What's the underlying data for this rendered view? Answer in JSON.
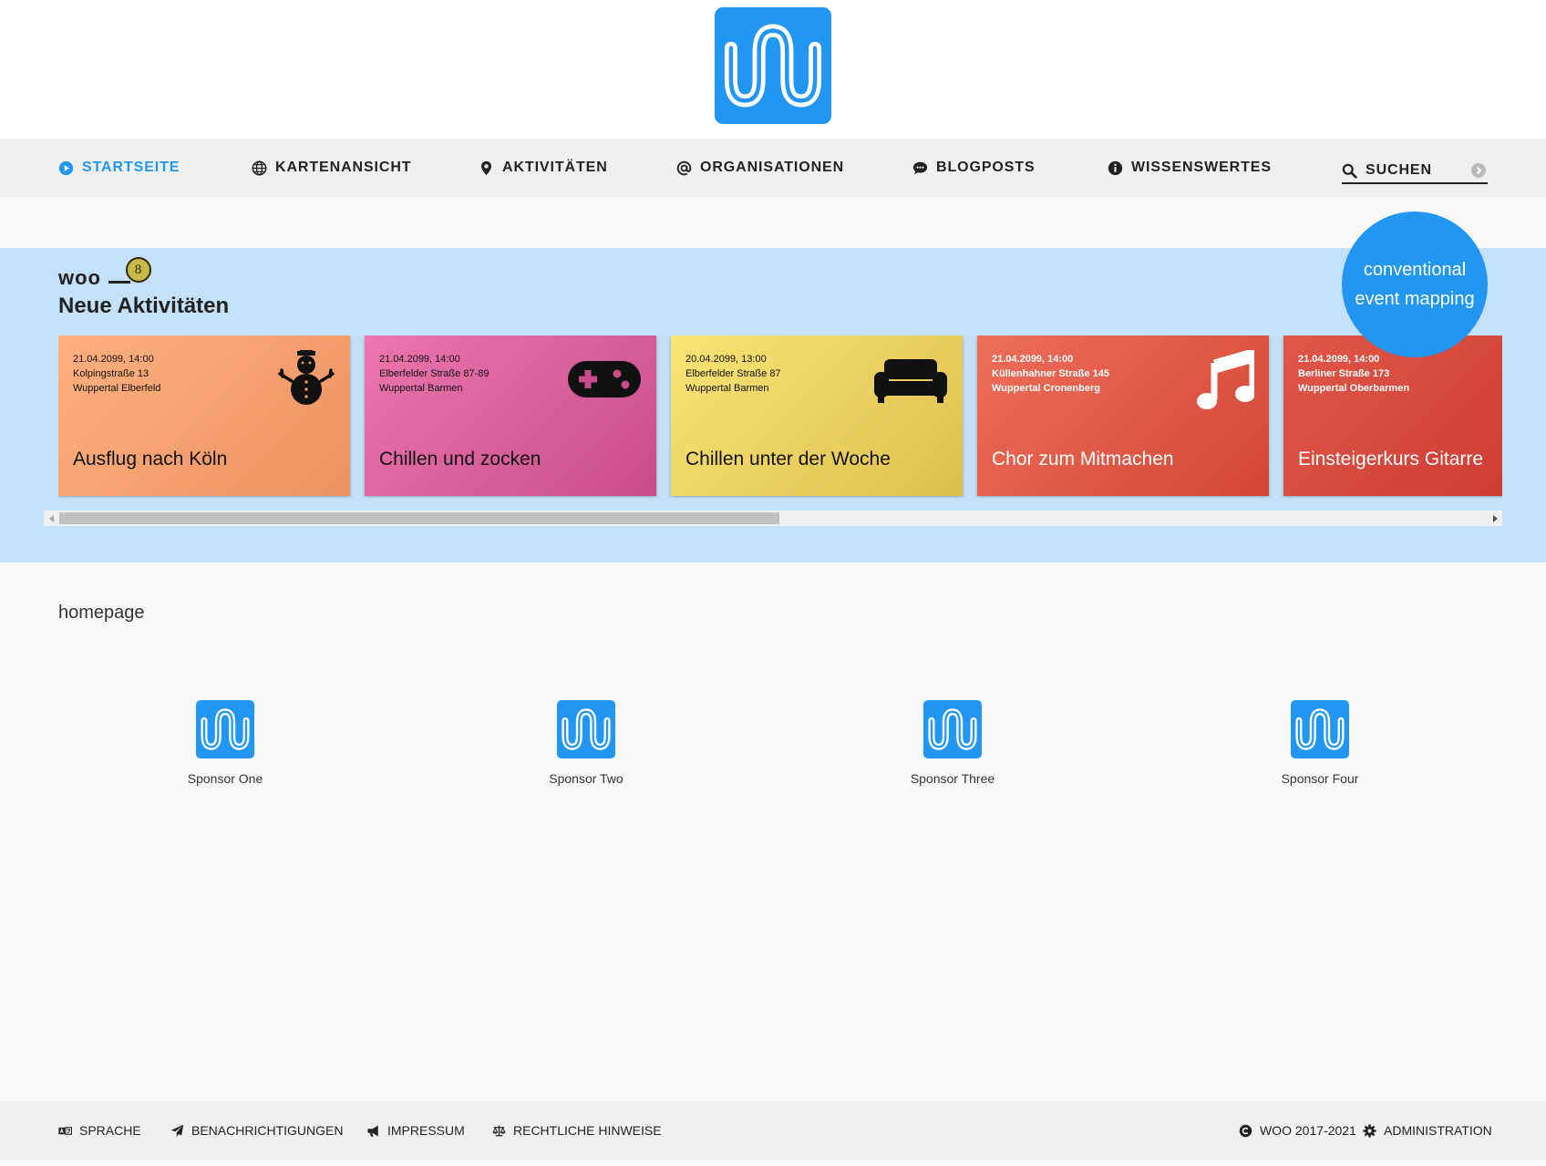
{
  "nav": {
    "items": [
      {
        "label": "STARTSEITE",
        "icon": "play-circle-icon",
        "active": true
      },
      {
        "label": "KARTENANSICHT",
        "icon": "globe-icon"
      },
      {
        "label": "AKTIVITÄTEN",
        "icon": "map-marker-icon"
      },
      {
        "label": "ORGANISATIONEN",
        "icon": "at-icon"
      },
      {
        "label": "BLOGPOSTS",
        "icon": "speech-bubble-icon"
      },
      {
        "label": "WISSENSWERTES",
        "icon": "info-circle-icon"
      }
    ],
    "search": {
      "placeholder": "SUCHEN",
      "icon": "search-icon",
      "submit_icon": "arrow-circle-right-icon"
    }
  },
  "activities": {
    "brand": "woo",
    "badge_count": "8",
    "section_title": "Neue Aktivitäten",
    "cards": [
      {
        "date": "21.04.2099, 14:00",
        "street": "Kolpingstraße 13",
        "city": "Wuppertal Elberfeld",
        "title": "Ausflug nach Köln",
        "icon": "snowman-icon",
        "colors": [
          "#ffb07f",
          "#ea9360"
        ],
        "text": "light"
      },
      {
        "date": "21.04.2099, 14:00",
        "street": "Elberfelder Straße 87-89",
        "city": "Wuppertal Barmen",
        "title": "Chillen und zocken",
        "icon": "gamepad-icon",
        "colors": [
          "#ec76ae",
          "#c94d8a"
        ],
        "text": "light"
      },
      {
        "date": "20.04.2099, 13:00",
        "street": "Elberfelder Straße 87",
        "city": "Wuppertal Barmen",
        "title": "Chillen unter der Woche",
        "icon": "couch-icon",
        "colors": [
          "#fbe375",
          "#dcc04f"
        ],
        "text": "light"
      },
      {
        "date": "21.04.2099, 14:00",
        "street": "Küllenhahner Straße 145",
        "city": "Wuppertal Cronenberg",
        "title": "Chor zum Mitmachen",
        "icon": "music-note-icon",
        "colors": [
          "#ee6e5a",
          "#d44636"
        ],
        "text": "dark"
      },
      {
        "date": "21.04.2099, 14:00",
        "street": "Berliner Straße 173",
        "city": "Wuppertal Oberbarmen",
        "title": "Einsteigerkurs Gitarre",
        "icon": "guitar-icon",
        "colors": [
          "#e2574a",
          "#c9392f"
        ],
        "text": "dark"
      }
    ],
    "scroll_position": 0.46
  },
  "bubble": {
    "line1": "conventional",
    "line2": "event mapping"
  },
  "main": {
    "text": "homepage",
    "sponsors": [
      {
        "name": "Sponsor One"
      },
      {
        "name": "Sponsor Two"
      },
      {
        "name": "Sponsor Three"
      },
      {
        "name": "Sponsor Four"
      }
    ]
  },
  "footer": {
    "links": [
      {
        "label": "SPRACHE",
        "icon": "language-icon"
      },
      {
        "label": "BENACHRICHTIGUNGEN",
        "icon": "paper-plane-icon"
      },
      {
        "label": "IMPRESSUM",
        "icon": "megaphone-icon"
      },
      {
        "label": "RECHTLICHE HINWEISE",
        "icon": "scales-icon"
      }
    ],
    "copyright": "WOO 2017-2021",
    "copyright_icon": "copyright-icon",
    "admin": "ADMINISTRATION",
    "admin_icon": "gear-icon"
  },
  "colors": {
    "accent": "#2196f3",
    "nav_bg": "#f0f0f0",
    "activities_bg": "#c5e1f7",
    "page_bg": "#f9f9f9",
    "badge": "#c8b84a"
  }
}
